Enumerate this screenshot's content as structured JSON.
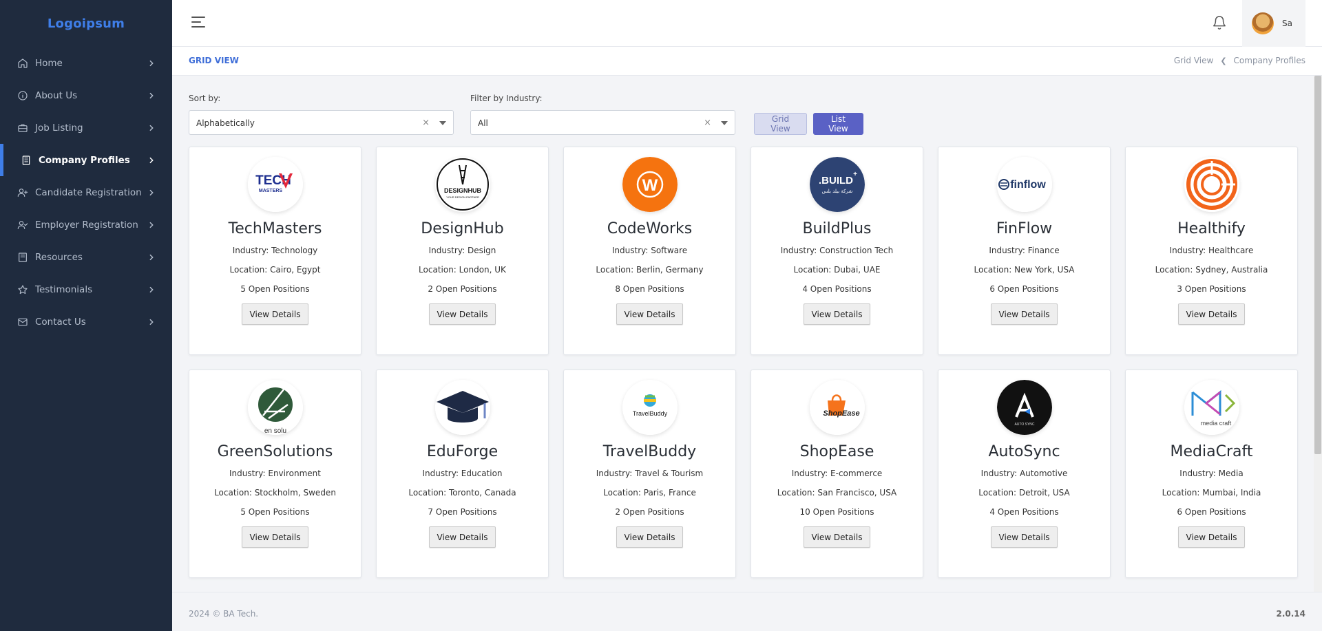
{
  "app": {
    "logo_text": "Logoipsum",
    "accent_color": "#3f7ee8",
    "sidebar_bg": "#1f2b3e"
  },
  "sidebar": {
    "items": [
      {
        "label": "Home",
        "icon": "home-icon",
        "active": false
      },
      {
        "label": "About Us",
        "icon": "info-icon",
        "active": false
      },
      {
        "label": "Job Listing",
        "icon": "briefcase-icon",
        "active": false
      },
      {
        "label": "Company Profiles",
        "icon": "building-icon",
        "active": true
      },
      {
        "label": "Candidate Registration",
        "icon": "user-plus-icon",
        "active": false
      },
      {
        "label": "Employer Registration",
        "icon": "user-check-icon",
        "active": false
      },
      {
        "label": "Resources",
        "icon": "book-icon",
        "active": false
      },
      {
        "label": "Testimonials",
        "icon": "star-icon",
        "active": false
      },
      {
        "label": "Contact Us",
        "icon": "mail-icon",
        "active": false
      }
    ]
  },
  "topbar": {
    "user_name": "Sa",
    "bell_icon": "bell-icon",
    "menu_icon": "hamburger-icon"
  },
  "page": {
    "title": "GRID VIEW",
    "breadcrumb": [
      "Grid View",
      "Company Profiles"
    ]
  },
  "filters": {
    "sort_label": "Sort by:",
    "sort_value": "Alphabetically",
    "industry_label": "Filter by Industry:",
    "industry_value": "All",
    "clear_symbol": "×",
    "grid_view_label": "Grid View",
    "list_view_label": "List View"
  },
  "companies": [
    {
      "name": "TechMasters",
      "industry": "Industry: Technology",
      "location": "Location: Cairo, Egypt",
      "positions": "5 Open Positions",
      "button": "View Details",
      "logo_text": "TECH",
      "logo_sub": "MASTERS",
      "logo_style": "techmasters"
    },
    {
      "name": "DesignHub",
      "industry": "Industry: Design",
      "location": "Location: London, UK",
      "positions": "2 Open Positions",
      "button": "View Details",
      "logo_text": "DESIGNHUB",
      "logo_sub": "YOUR DESIGN PARTNER",
      "logo_style": "designhub"
    },
    {
      "name": "CodeWorks",
      "industry": "Industry: Software",
      "location": "Location: Berlin, Germany",
      "positions": "8 Open Positions",
      "button": "View Details",
      "logo_text": "W",
      "logo_sub": "",
      "logo_style": "codeworks"
    },
    {
      "name": "BuildPlus",
      "industry": "Industry: Construction Tech",
      "location": "Location: Dubai, UAE",
      "positions": "4 Open Positions",
      "button": "View Details",
      "logo_text": ".BUILD",
      "logo_sub": "شركة بيلد بلس",
      "logo_style": "buildplus"
    },
    {
      "name": "FinFlow",
      "industry": "Industry: Finance",
      "location": "Location: New York, USA",
      "positions": "6 Open Positions",
      "button": "View Details",
      "logo_text": "finflow",
      "logo_sub": "",
      "logo_style": "finflow"
    },
    {
      "name": "Healthify",
      "industry": "Industry: Healthcare",
      "location": "Location: Sydney, Australia",
      "positions": "3 Open Positions",
      "button": "View Details",
      "logo_text": "",
      "logo_sub": "",
      "logo_style": "healthify"
    },
    {
      "name": "GreenSolutions",
      "industry": "Industry: Environment",
      "location": "Location: Stockholm, Sweden",
      "positions": "5 Open Positions",
      "button": "View Details",
      "logo_text": "en solu",
      "logo_sub": "",
      "logo_style": "greensolutions"
    },
    {
      "name": "EduForge",
      "industry": "Industry: Education",
      "location": "Location: Toronto, Canada",
      "positions": "7 Open Positions",
      "button": "View Details",
      "logo_text": "",
      "logo_sub": "",
      "logo_style": "eduforge"
    },
    {
      "name": "TravelBuddy",
      "industry": "Industry: Travel & Tourism",
      "location": "Location: Paris, France",
      "positions": "2 Open Positions",
      "button": "View Details",
      "logo_text": "TravelBuddy",
      "logo_sub": "",
      "logo_style": "travelbuddy"
    },
    {
      "name": "ShopEase",
      "industry": "Industry: E-commerce",
      "location": "Location: San Francisco, USA",
      "positions": "10 Open Positions",
      "button": "View Details",
      "logo_text": "ShopEase",
      "logo_sub": "",
      "logo_style": "shopease"
    },
    {
      "name": "AutoSync",
      "industry": "Industry: Automotive",
      "location": "Location: Detroit, USA",
      "positions": "4 Open Positions",
      "button": "View Details",
      "logo_text": "AUTO SYNC",
      "logo_sub": "",
      "logo_style": "autosync"
    },
    {
      "name": "MediaCraft",
      "industry": "Industry: Media",
      "location": "Location: Mumbai, India",
      "positions": "6 Open Positions",
      "button": "View Details",
      "logo_text": "media craft",
      "logo_sub": "",
      "logo_style": "mediacraft"
    }
  ],
  "footer": {
    "copyright": "2024 © BA Tech.",
    "version": "2.0.14"
  }
}
